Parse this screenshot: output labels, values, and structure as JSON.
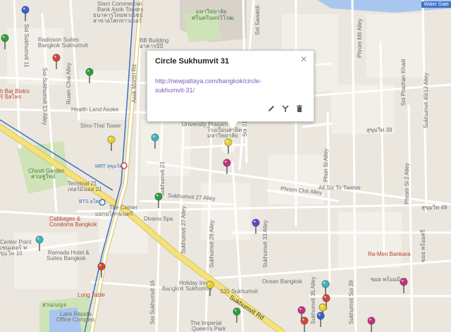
{
  "map": {
    "colors": {
      "land": "#ebe7df",
      "block": "#f2efe9",
      "road": "#ffffff",
      "major_road": "#f5e27a",
      "major_road_stroke": "#d8c15c",
      "rail": "#3b6fbe",
      "park": "#cfe3b8",
      "water": "#a9c7ee",
      "campus": "#d9d2c8"
    },
    "labels": {
      "siam_commercial": "Siam Commercial",
      "bank_asok_towers": "Bank Asok Towers",
      "thai_bank_1": "ธนาคารไทยพาณิชย์",
      "thai_bank_2": "สาขาอโศกทาวเวอร์",
      "university": "มหาวิทยาลัย",
      "srinakharinwirot": "ศรีนครินทรวิโรฒ",
      "radisson": "Radisson Suites",
      "radisson_2": "Bangkok Sukhumvit",
      "bb_building": "BB Building",
      "bb_thai": "อาคารบีบี",
      "soi_sukhumvit_11": "Soi Sukhumvit 11",
      "soi_13": "Soi Sukhumvit 13 Alley",
      "ruam_chai": "Ruam Chai Alley",
      "bar_bistro": "h Bar Bistro",
      "bar_bistro_thai": "ร์ บิสโทร",
      "health_land": "Health Land Asoke",
      "sino_thai": "Sino-Thai Tower",
      "asok_montri": "Asok Montri Rd",
      "soi_sawatdi": "Soi Sawatdi",
      "university_prasarn": "University Prasarn",
      "uni_thai_1": "โรงเรียนสาธิต",
      "uni_thai_2": "มหาวิทยาลัย",
      "soi_31": "Soi 31",
      "phrom_mit": "Phrom Mit Alley",
      "soi_prachan": "Soi Prachan Khadi",
      "soi_49_13": "Sukhumvit 49/13 Alley",
      "phon_si": "Phon Si Alley",
      "phrom_si_2": "Phrom Si 2 Alley",
      "soi_39": "Sukhumvit 39",
      "chuvit_garden": "Chuvit Garden",
      "chuvit_thai": "สวนชูวิทย์",
      "mrt": "MRT สุขุมวิท",
      "terminal_21": "Terminal 21",
      "terminal_thai": "เทอร์มินอล 21",
      "bts": "BTS อโศก",
      "the_corner": "The Corner",
      "corner_thai": "แยกอโศกมนตรี",
      "sukhumvit_27": "Sukhumvit 27 Alley",
      "sukhumvit_23": "Sukhumvit 23",
      "sukhumvit_27b": "Sukhumvit 27 Alley",
      "sukhumvit_29": "Sukhumvit 29 Alley",
      "sukhumvit_33": "Sukhumvit 33 Alley",
      "phrom_chit": "Phrom Chit Alley",
      "all_six": "All Six To Twelve",
      "sukhumvit_thai": "สุขุมวิท 39",
      "cabbages": "Cabbages &",
      "cabbages_2": "Condoms Bangkok",
      "divana": "Divana Spa",
      "center_point": "Center Point",
      "center_thai": "เซนเตอร์ พ",
      "center_10": "ขุมวิท 10",
      "ramada": "Ramada Hotel &",
      "ramada_2": "Suites Bangkok",
      "ocean": "Ocean Bangkok",
      "ra_men": "Ra-Men Bankara",
      "holiday_inn": "Holiday Inn",
      "holiday_inn_2": "Bangkok Sukhumvit",
      "s31": "S31 Sukhumvit",
      "long_table": "Long Table",
      "lake_rajada": "Lake Rajada",
      "lake_rajada_2": "Office Complex",
      "suan": "สวนเบญจ",
      "sukhumvit_rd": "Sukhumvit Rd",
      "imperial": "The Imperial",
      "imperial_2": "Queen's Park",
      "soi_16": "Soi Sukhumvit 16",
      "soi_35": "Sukhumvit 35 Alley",
      "soi_39b": "Sukhumvit Soi 39",
      "soi_phrom": "ซอย พร้อมมิตร",
      "soi_phrom_si": "ซอย พร้อมศรี",
      "water_gate": "Water Gate",
      "sukhumvit_49": "สุขุมวิท 49"
    },
    "info_window": {
      "title": "Circle Sukhumvit 31",
      "link": "http://newpattaya.com/bangkok/circle-sukhumvit-31/",
      "close_icon": "close-icon",
      "edit_icon": "pencil-icon",
      "style_icon": "paint-icon",
      "delete_icon": "trash-icon"
    },
    "pins": [
      {
        "color": "#3b5fd4"
      },
      {
        "color": "#2e9e3a"
      },
      {
        "color": "#d6453a"
      },
      {
        "color": "#2e9e3a"
      },
      {
        "color": "#3bb4c1"
      },
      {
        "color": "#e7d32a"
      },
      {
        "color": "#e7d32a"
      },
      {
        "color": "#c5307e"
      },
      {
        "color": "#2e9e3a"
      },
      {
        "color": "#3bb4c1"
      },
      {
        "color": "#6b3fd0"
      },
      {
        "color": "#d6453a"
      },
      {
        "color": "#e7d32a"
      },
      {
        "color": "#2e9e3a"
      },
      {
        "color": "#3bb4c1"
      },
      {
        "color": "#d6453a"
      },
      {
        "color": "#e7d32a"
      },
      {
        "color": "#c5307e"
      },
      {
        "color": "#3b5fd4"
      },
      {
        "color": "#d6453a"
      },
      {
        "color": "#c5307e"
      },
      {
        "color": "#c5307e"
      }
    ]
  }
}
